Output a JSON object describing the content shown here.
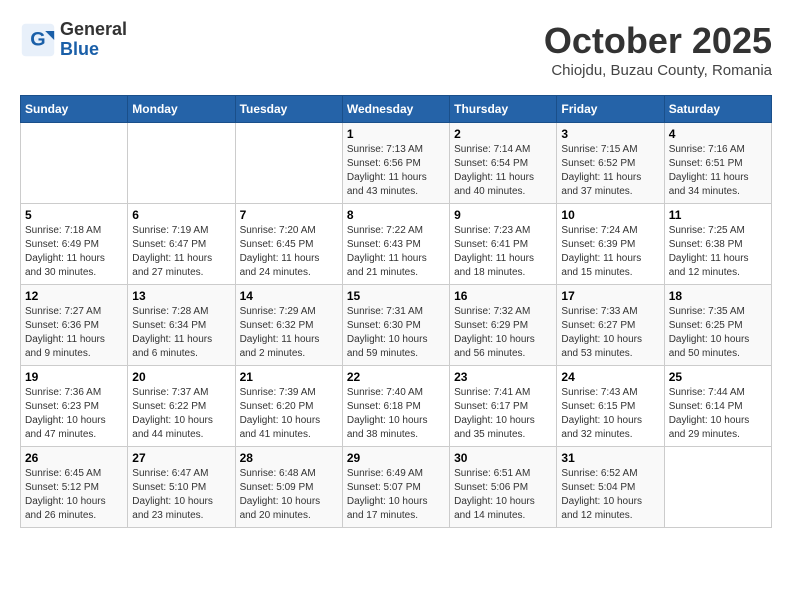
{
  "header": {
    "logo_general": "General",
    "logo_blue": "Blue",
    "month_title": "October 2025",
    "subtitle": "Chiojdu, Buzau County, Romania"
  },
  "days_of_week": [
    "Sunday",
    "Monday",
    "Tuesday",
    "Wednesday",
    "Thursday",
    "Friday",
    "Saturday"
  ],
  "weeks": [
    [
      {
        "day": "",
        "info": ""
      },
      {
        "day": "",
        "info": ""
      },
      {
        "day": "",
        "info": ""
      },
      {
        "day": "1",
        "info": "Sunrise: 7:13 AM\nSunset: 6:56 PM\nDaylight: 11 hours and 43 minutes."
      },
      {
        "day": "2",
        "info": "Sunrise: 7:14 AM\nSunset: 6:54 PM\nDaylight: 11 hours and 40 minutes."
      },
      {
        "day": "3",
        "info": "Sunrise: 7:15 AM\nSunset: 6:52 PM\nDaylight: 11 hours and 37 minutes."
      },
      {
        "day": "4",
        "info": "Sunrise: 7:16 AM\nSunset: 6:51 PM\nDaylight: 11 hours and 34 minutes."
      }
    ],
    [
      {
        "day": "5",
        "info": "Sunrise: 7:18 AM\nSunset: 6:49 PM\nDaylight: 11 hours and 30 minutes."
      },
      {
        "day": "6",
        "info": "Sunrise: 7:19 AM\nSunset: 6:47 PM\nDaylight: 11 hours and 27 minutes."
      },
      {
        "day": "7",
        "info": "Sunrise: 7:20 AM\nSunset: 6:45 PM\nDaylight: 11 hours and 24 minutes."
      },
      {
        "day": "8",
        "info": "Sunrise: 7:22 AM\nSunset: 6:43 PM\nDaylight: 11 hours and 21 minutes."
      },
      {
        "day": "9",
        "info": "Sunrise: 7:23 AM\nSunset: 6:41 PM\nDaylight: 11 hours and 18 minutes."
      },
      {
        "day": "10",
        "info": "Sunrise: 7:24 AM\nSunset: 6:39 PM\nDaylight: 11 hours and 15 minutes."
      },
      {
        "day": "11",
        "info": "Sunrise: 7:25 AM\nSunset: 6:38 PM\nDaylight: 11 hours and 12 minutes."
      }
    ],
    [
      {
        "day": "12",
        "info": "Sunrise: 7:27 AM\nSunset: 6:36 PM\nDaylight: 11 hours and 9 minutes."
      },
      {
        "day": "13",
        "info": "Sunrise: 7:28 AM\nSunset: 6:34 PM\nDaylight: 11 hours and 6 minutes."
      },
      {
        "day": "14",
        "info": "Sunrise: 7:29 AM\nSunset: 6:32 PM\nDaylight: 11 hours and 2 minutes."
      },
      {
        "day": "15",
        "info": "Sunrise: 7:31 AM\nSunset: 6:30 PM\nDaylight: 10 hours and 59 minutes."
      },
      {
        "day": "16",
        "info": "Sunrise: 7:32 AM\nSunset: 6:29 PM\nDaylight: 10 hours and 56 minutes."
      },
      {
        "day": "17",
        "info": "Sunrise: 7:33 AM\nSunset: 6:27 PM\nDaylight: 10 hours and 53 minutes."
      },
      {
        "day": "18",
        "info": "Sunrise: 7:35 AM\nSunset: 6:25 PM\nDaylight: 10 hours and 50 minutes."
      }
    ],
    [
      {
        "day": "19",
        "info": "Sunrise: 7:36 AM\nSunset: 6:23 PM\nDaylight: 10 hours and 47 minutes."
      },
      {
        "day": "20",
        "info": "Sunrise: 7:37 AM\nSunset: 6:22 PM\nDaylight: 10 hours and 44 minutes."
      },
      {
        "day": "21",
        "info": "Sunrise: 7:39 AM\nSunset: 6:20 PM\nDaylight: 10 hours and 41 minutes."
      },
      {
        "day": "22",
        "info": "Sunrise: 7:40 AM\nSunset: 6:18 PM\nDaylight: 10 hours and 38 minutes."
      },
      {
        "day": "23",
        "info": "Sunrise: 7:41 AM\nSunset: 6:17 PM\nDaylight: 10 hours and 35 minutes."
      },
      {
        "day": "24",
        "info": "Sunrise: 7:43 AM\nSunset: 6:15 PM\nDaylight: 10 hours and 32 minutes."
      },
      {
        "day": "25",
        "info": "Sunrise: 7:44 AM\nSunset: 6:14 PM\nDaylight: 10 hours and 29 minutes."
      }
    ],
    [
      {
        "day": "26",
        "info": "Sunrise: 6:45 AM\nSunset: 5:12 PM\nDaylight: 10 hours and 26 minutes."
      },
      {
        "day": "27",
        "info": "Sunrise: 6:47 AM\nSunset: 5:10 PM\nDaylight: 10 hours and 23 minutes."
      },
      {
        "day": "28",
        "info": "Sunrise: 6:48 AM\nSunset: 5:09 PM\nDaylight: 10 hours and 20 minutes."
      },
      {
        "day": "29",
        "info": "Sunrise: 6:49 AM\nSunset: 5:07 PM\nDaylight: 10 hours and 17 minutes."
      },
      {
        "day": "30",
        "info": "Sunrise: 6:51 AM\nSunset: 5:06 PM\nDaylight: 10 hours and 14 minutes."
      },
      {
        "day": "31",
        "info": "Sunrise: 6:52 AM\nSunset: 5:04 PM\nDaylight: 10 hours and 12 minutes."
      },
      {
        "day": "",
        "info": ""
      }
    ]
  ]
}
